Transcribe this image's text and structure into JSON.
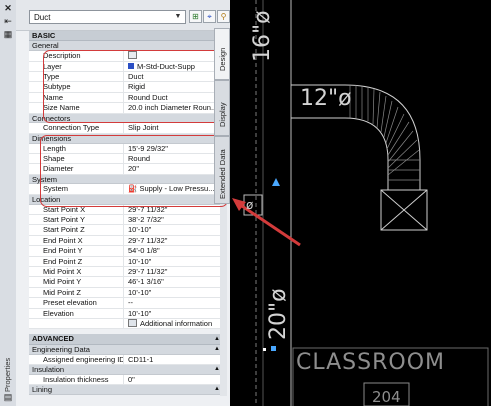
{
  "toolbar": {
    "object_type": "Duct",
    "tab_design": "Design",
    "tab_display": "Display",
    "tab_extended": "Extended Data",
    "panel_title": "Properties"
  },
  "basic": {
    "title": "BASIC",
    "general": {
      "title": "General",
      "rows": [
        {
          "key": "Description",
          "value": ""
        },
        {
          "key": "Layer",
          "value": "M-Std-Duct-Supp"
        },
        {
          "key": "Type",
          "value": "Duct"
        },
        {
          "key": "Subtype",
          "value": "Rigid"
        },
        {
          "key": "Name",
          "value": "Round Duct"
        },
        {
          "key": "Size Name",
          "value": "20.0 inch Diameter Roun..."
        }
      ]
    },
    "connectors": {
      "title": "Connectors",
      "rows": [
        {
          "key": "Connection Type",
          "value": "Slip Joint"
        }
      ]
    },
    "dimensions": {
      "title": "Dimensions",
      "rows": [
        {
          "key": "Length",
          "value": "15'-9 29/32\""
        },
        {
          "key": "Shape",
          "value": "Round"
        },
        {
          "key": "Diameter",
          "value": "20\""
        }
      ]
    },
    "system": {
      "title": "System",
      "rows": [
        {
          "key": "System",
          "value": "Supply - Low Pressu..."
        }
      ]
    },
    "location": {
      "title": "Location",
      "rows": [
        {
          "key": "Start Point X",
          "value": "29'-7 11/32\""
        },
        {
          "key": "Start Point Y",
          "value": "38'-2 7/32\""
        },
        {
          "key": "Start Point Z",
          "value": "10'-10\""
        },
        {
          "key": "End Point X",
          "value": "29'-7 11/32\""
        },
        {
          "key": "End Point Y",
          "value": "54'-0 1/8\""
        },
        {
          "key": "End Point Z",
          "value": "10'-10\""
        },
        {
          "key": "Mid Point X",
          "value": "29'-7 11/32\""
        },
        {
          "key": "Mid Point Y",
          "value": "46'-1 3/16\""
        },
        {
          "key": "Mid Point Z",
          "value": "10'-10\""
        },
        {
          "key": "Preset elevation",
          "value": "--"
        },
        {
          "key": "Elevation",
          "value": "10'-10\""
        },
        {
          "key": "",
          "value": "Additional information"
        }
      ]
    }
  },
  "advanced": {
    "title": "ADVANCED",
    "engineering": {
      "title": "Engineering Data",
      "rows": [
        {
          "key": "Assigned engineering ID",
          "value": "CD11-1"
        }
      ]
    },
    "insulation": {
      "title": "Insulation",
      "rows": [
        {
          "key": "Insulation thickness",
          "value": "0\""
        }
      ]
    },
    "lining": {
      "title": "Lining"
    }
  },
  "drawing": {
    "label_16": "16\"ø",
    "label_12": "12\"ø",
    "label_20": "20\"ø",
    "label_phi": "ø",
    "room_name": "CLASSROOM",
    "room_number": "204"
  },
  "colors": {
    "highlight": "#d33b3b",
    "layer_swatch": "#2b4fc4",
    "cad_bg": "#000000"
  }
}
